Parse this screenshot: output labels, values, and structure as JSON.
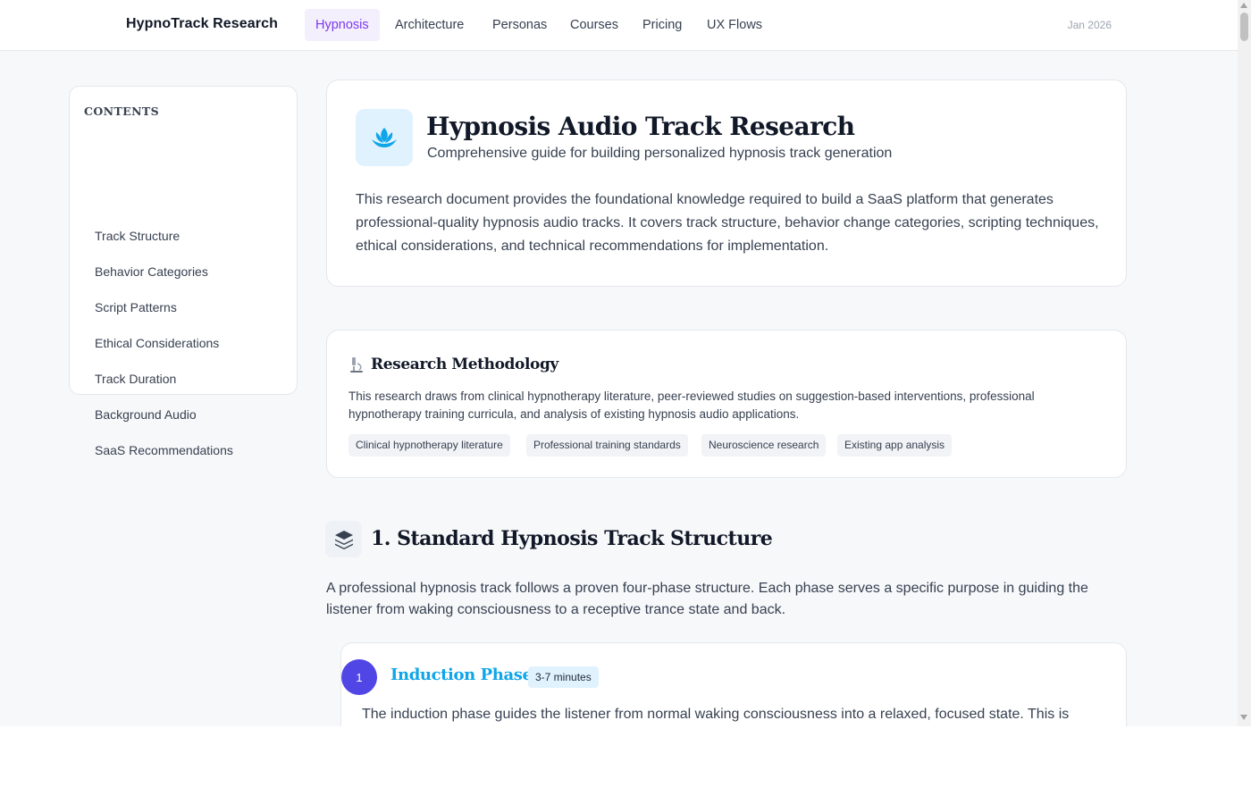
{
  "nav": {
    "brand": "HypnoTrack Research",
    "items": [
      {
        "label": "Hypnosis",
        "active": true
      },
      {
        "label": "Architecture",
        "active": false
      },
      {
        "label": "Personas",
        "active": false
      },
      {
        "label": "Courses",
        "active": false
      },
      {
        "label": "Pricing",
        "active": false
      },
      {
        "label": "UX Flows",
        "active": false
      }
    ],
    "date": "Jan 2026"
  },
  "toc": {
    "title": "CONTENTS",
    "links": [
      "Track Structure",
      "Behavior Categories",
      "Script Patterns",
      "Ethical Considerations",
      "Track Duration",
      "Background Audio",
      "SaaS Recommendations"
    ]
  },
  "hero": {
    "icon": "lotus-icon",
    "title": "Hypnosis Audio Track Research",
    "subtitle": "Comprehensive guide for building personalized hypnosis track generation",
    "body": "This research document provides the foundational knowledge required to build a SaaS platform that generates professional-quality hypnosis audio tracks. It covers track structure, behavior change categories, scripting techniques, ethical considerations, and technical recommendations for implementation."
  },
  "methodology": {
    "icon": "microscope-icon",
    "title": "Research Methodology",
    "body": "This research draws from clinical hypnotherapy literature, peer-reviewed studies on suggestion-based interventions, professional hypnotherapy training curricula, and analysis of existing hypnosis audio applications.",
    "tags": [
      "Clinical hypnotherapy literature",
      "Professional training standards",
      "Neuroscience research",
      "Existing app analysis"
    ]
  },
  "section1": {
    "icon": "layers-icon",
    "title": "1. Standard Hypnosis Track Structure",
    "body": "A professional hypnosis track follows a proven four-phase structure. Each phase serves a specific purpose in guiding the listener from waking consciousness to a receptive trance state and back."
  },
  "phase1": {
    "number": "1",
    "title": "Induction Phase",
    "duration": "3-7 minutes",
    "body": "The induction phase guides the listener from normal waking consciousness into a relaxed, focused state. This is"
  },
  "colors": {
    "accent": "#7c3aed",
    "phase_number": "#4f46e5",
    "phase_title": "#0ea5e9",
    "hero_icon_bg": "#e0f2fe"
  }
}
